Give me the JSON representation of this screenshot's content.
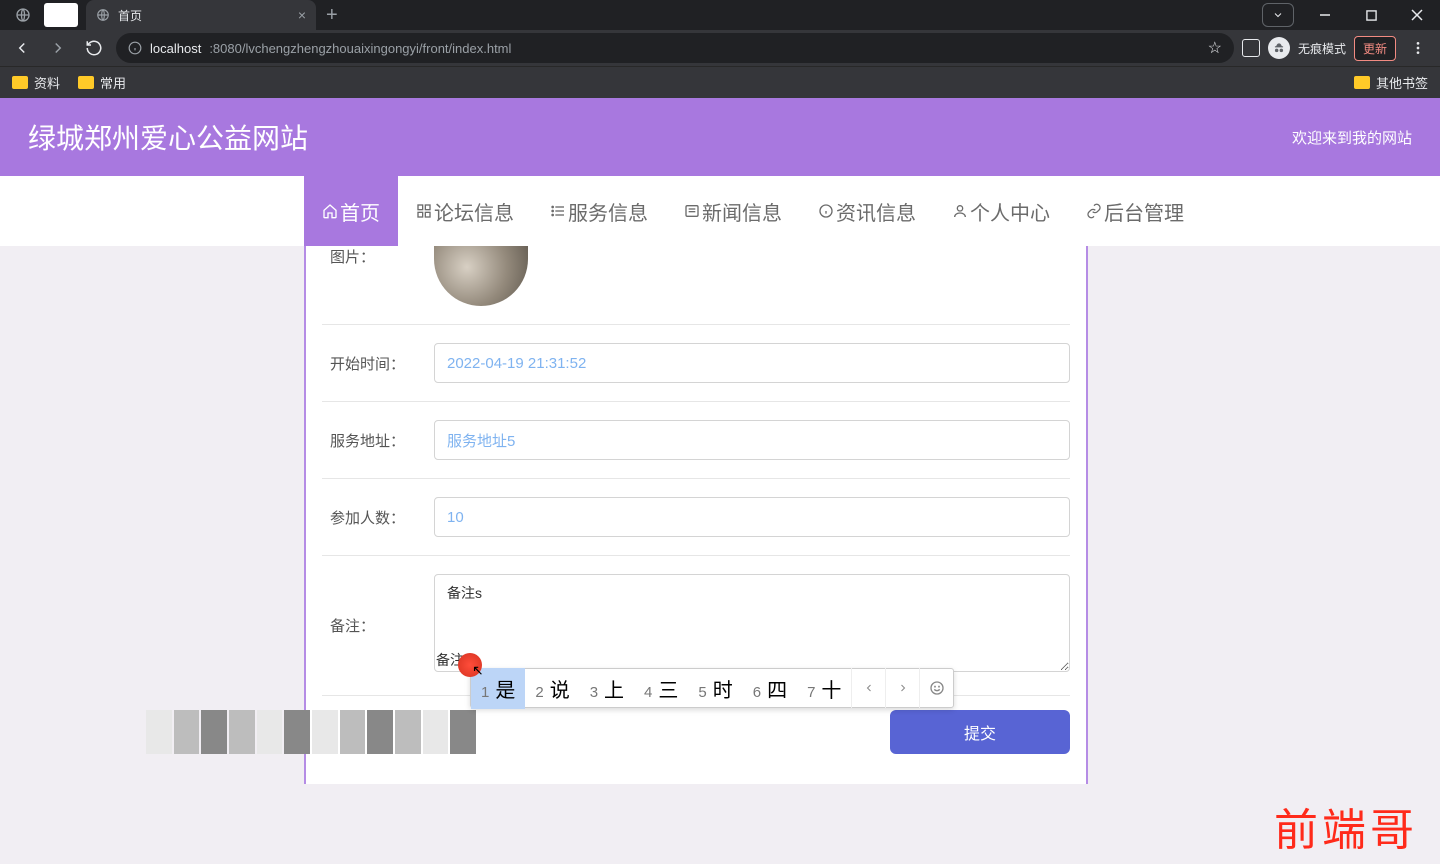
{
  "browser": {
    "tab_title": "首页",
    "url_host": "localhost",
    "url_port_path": ":8080/lvchengzhengzhouaixingongyi/front/index.html",
    "incognito_label": "无痕模式",
    "update_label": "更新",
    "bookmarks": [
      "资料",
      "常用"
    ],
    "other_bookmarks": "其他书签"
  },
  "site": {
    "title": "绿城郑州爱心公益网站",
    "welcome": "欢迎来到我的网站"
  },
  "nav": [
    {
      "label": "首页",
      "active": true
    },
    {
      "label": "论坛信息",
      "active": false
    },
    {
      "label": "服务信息",
      "active": false
    },
    {
      "label": "新闻信息",
      "active": false
    },
    {
      "label": "资讯信息",
      "active": false
    },
    {
      "label": "个人中心",
      "active": false
    },
    {
      "label": "后台管理",
      "active": false
    }
  ],
  "form": {
    "image_label": "图片：",
    "start_time_label": "开始时间：",
    "start_time_value": "2022-04-19 21:31:52",
    "address_label": "服务地址：",
    "address_value": "服务地址5",
    "people_label": "参加人数：",
    "people_value": "10",
    "remark_label": "备注：",
    "remark_value": "备注s",
    "submit": "提交"
  },
  "ime": {
    "preedit": "s",
    "candidates": [
      {
        "n": "1",
        "w": "是"
      },
      {
        "n": "2",
        "w": "说"
      },
      {
        "n": "3",
        "w": "上"
      },
      {
        "n": "4",
        "w": "三"
      },
      {
        "n": "5",
        "w": "时"
      },
      {
        "n": "6",
        "w": "四"
      },
      {
        "n": "7",
        "w": "十"
      }
    ]
  },
  "watermark": "前端哥"
}
